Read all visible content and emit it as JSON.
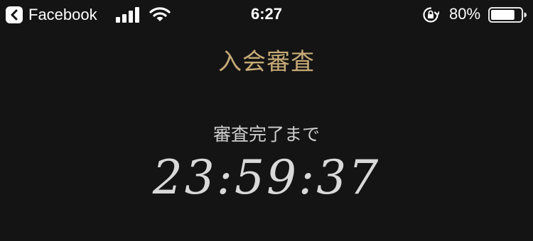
{
  "status_bar": {
    "back_app_label": "Facebook",
    "time": "6:27",
    "battery_percent": "80%",
    "battery_level": 0.8,
    "icons": [
      "back-chevron-icon",
      "signal-icon",
      "wifi-icon",
      "orientation-lock-icon",
      "battery-icon"
    ]
  },
  "page": {
    "title": "入会審査",
    "countdown_label": "審査完了まで",
    "countdown_value": "23:59:37"
  },
  "colors": {
    "background": "#141414",
    "title_gold": "#c7ab77",
    "label_gray": "#cfcfcf",
    "timer_gray": "#d9d9d9"
  }
}
